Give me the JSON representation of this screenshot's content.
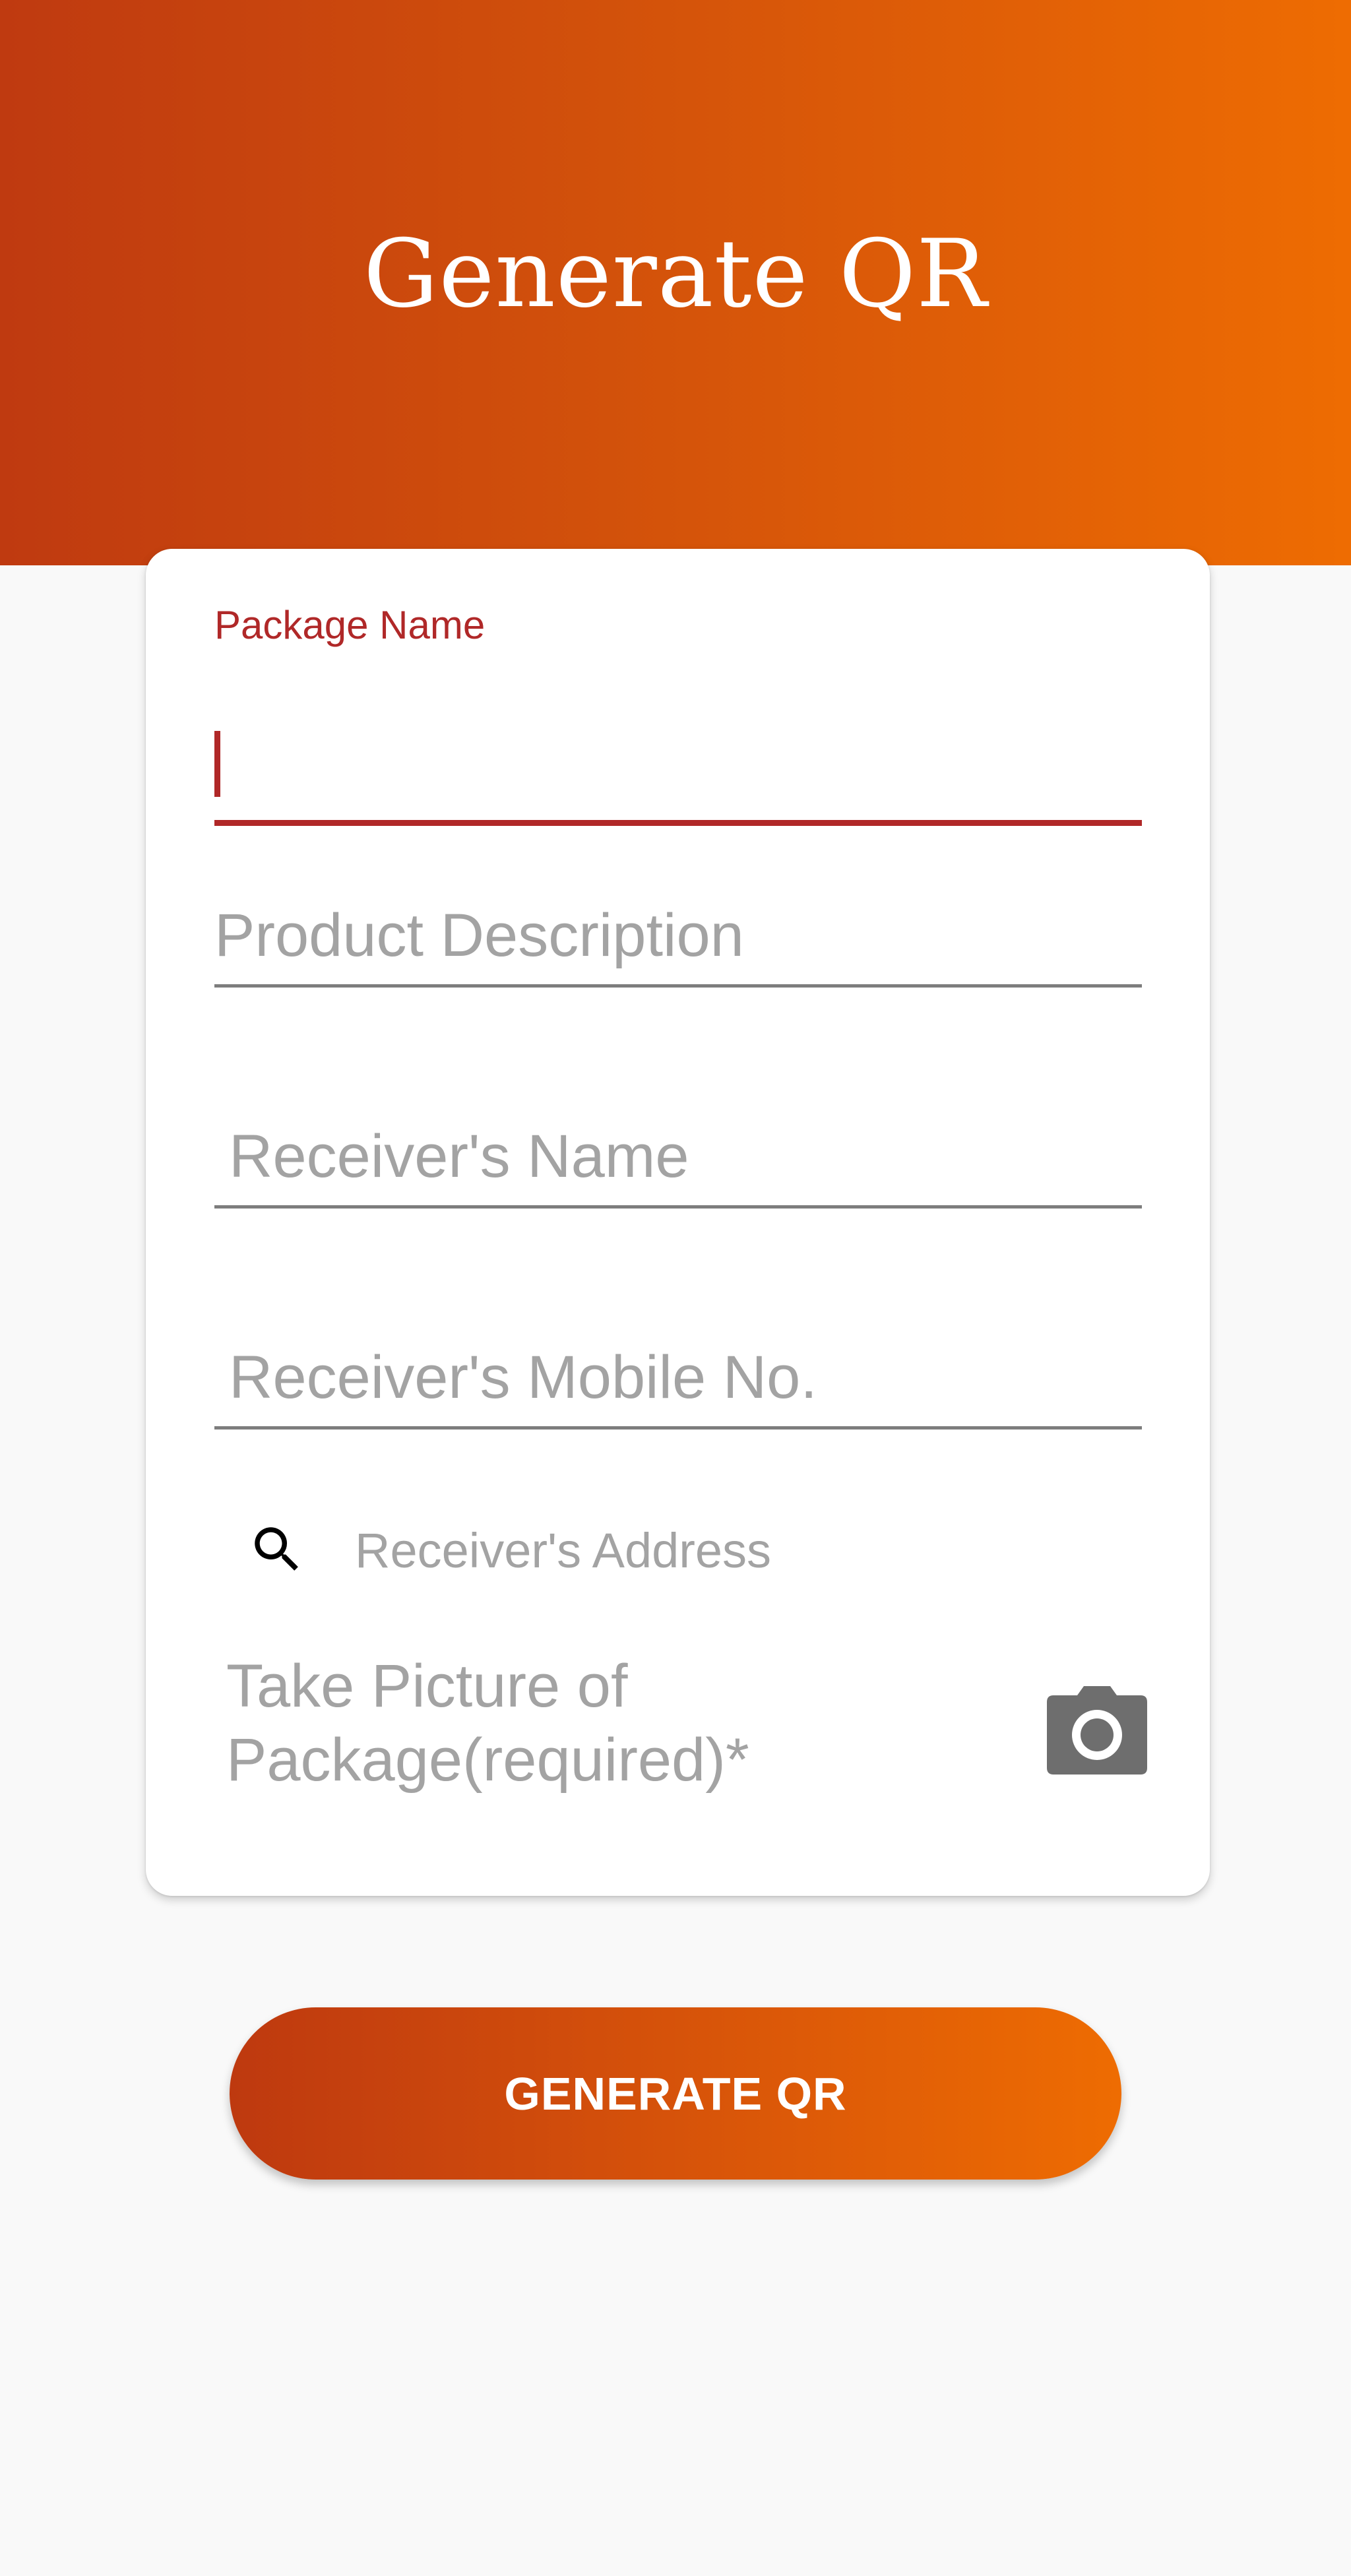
{
  "header": {
    "title": "Generate QR"
  },
  "form": {
    "package_name": {
      "label": "Package Name",
      "value": ""
    },
    "product_description": {
      "placeholder": "Product Description"
    },
    "receiver_name": {
      "placeholder": "Receiver's Name"
    },
    "receiver_mobile": {
      "placeholder": "Receiver's Mobile No."
    },
    "receiver_address": {
      "icon": "search-icon",
      "placeholder": "Receiver's Address"
    },
    "picture": {
      "label": "Take Picture of Package(required)*",
      "icon": "camera-icon"
    }
  },
  "actions": {
    "generate_label": "GENERATE QR"
  },
  "colors": {
    "gradient_start": "#bf3a10",
    "gradient_end": "#ee6c02",
    "focus_accent": "#b02828",
    "placeholder": "#a3a3a3",
    "background": "#f9f9f9"
  }
}
